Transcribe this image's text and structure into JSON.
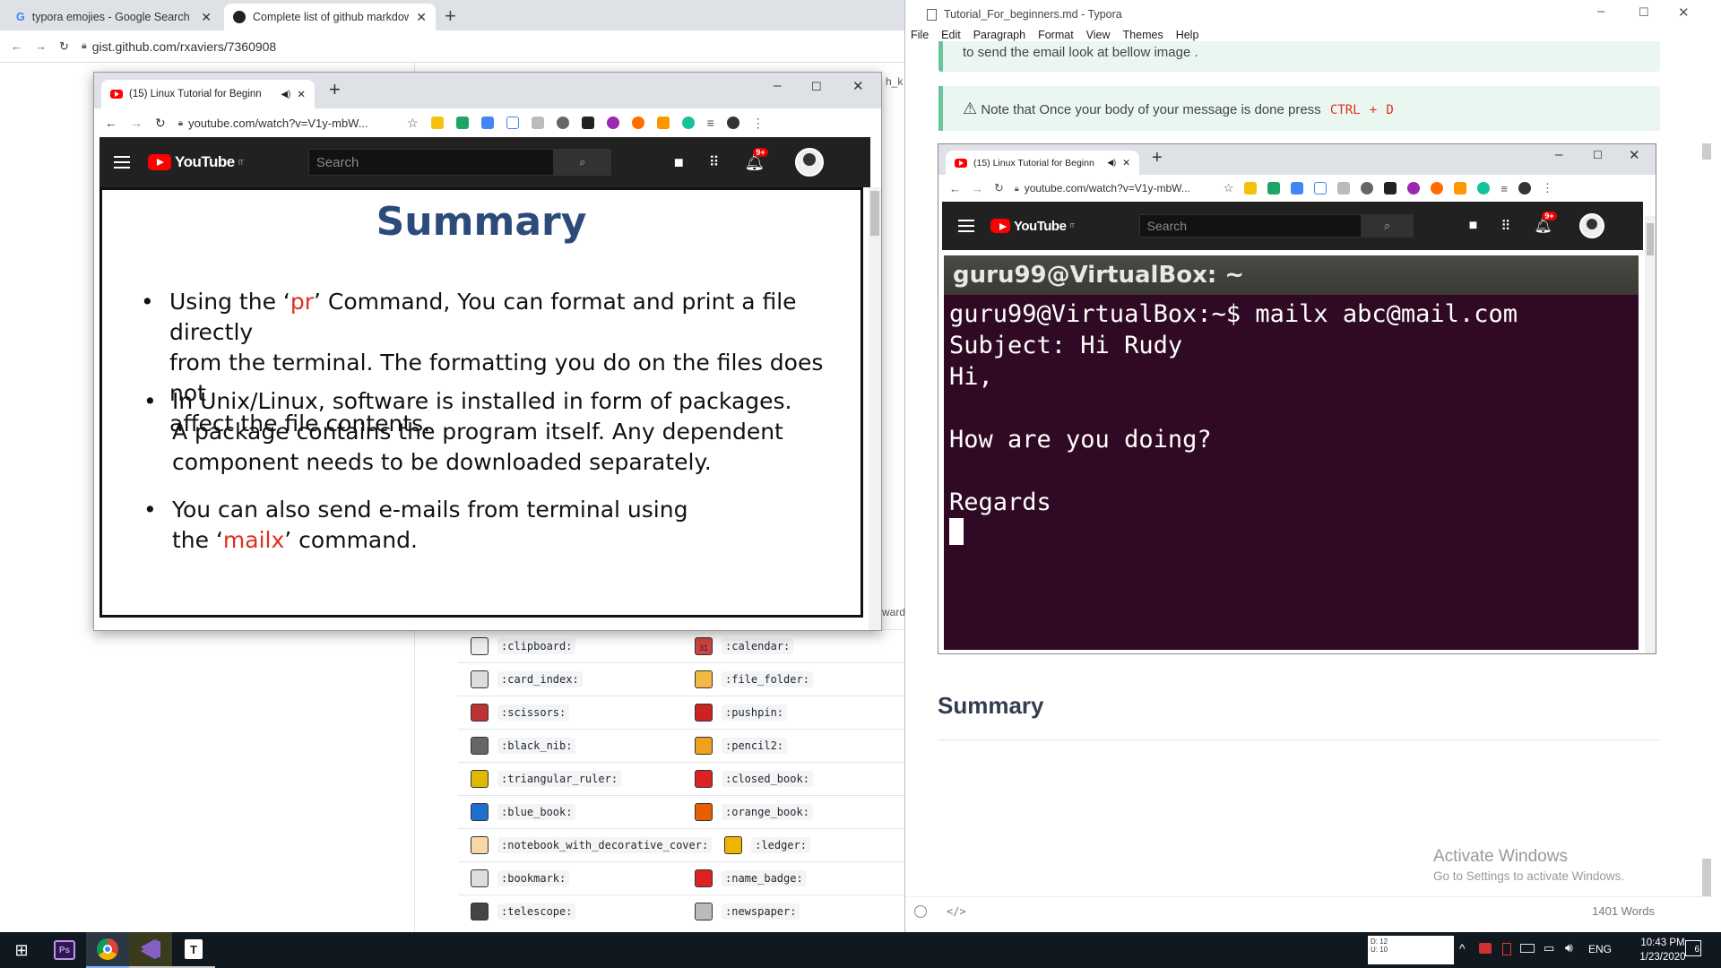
{
  "bg_browser": {
    "tabs": [
      {
        "title": "typora emojies - Google Search",
        "favicon": "google-icon"
      },
      {
        "title": "Complete list of github markdow",
        "favicon": "github-icon"
      }
    ],
    "url": "gist.github.com/rxaviers/7360908"
  },
  "emoji_table": {
    "rows": [
      {
        "left": ":clipboard:",
        "right": ":calendar:"
      },
      {
        "left": ":card_index:",
        "right": ":file_folder:"
      },
      {
        "left": ":scissors:",
        "right": ":pushpin:"
      },
      {
        "left": ":black_nib:",
        "right": ":pencil2:"
      },
      {
        "left": ":triangular_ruler:",
        "right": ":closed_book:"
      },
      {
        "left": ":blue_book:",
        "right": ":orange_book:"
      },
      {
        "left": ":notebook_with_decorative_cover:",
        "right": ":ledger:"
      },
      {
        "left": ":bookmark:",
        "right": ":name_badge:"
      },
      {
        "left": ":telescope:",
        "right": ":newspaper:"
      }
    ],
    "edge_fragments": {
      "top": "h_k",
      "mid": "ward"
    },
    "calendar_day": "31"
  },
  "yt_window_1": {
    "tab_title": "(15) Linux Tutorial for Beginn",
    "url": "youtube.com/watch?v=V1y-mbW...",
    "search_placeholder": "Search",
    "logo": "YouTube",
    "logo_sup": "IT",
    "notif_badge": "9+",
    "slide": {
      "title": "Summary",
      "b1_a": "Using the ‘",
      "b1_cmd": "pr",
      "b1_b": "’ Command, You can format and print a file directly",
      "b1_c": "from the terminal. The formatting you do on the files does not",
      "b1_d": "affect the file contents.",
      "b2_a": "In Unix/Linux, software is installed in form of packages.",
      "b2_b": "A package contains the program itself. Any dependent",
      "b2_c": "component needs to be downloaded separately.",
      "b3_a": "You can also send e-mails from terminal using",
      "b3_b": "the ‘",
      "b3_cmd": "mailx",
      "b3_c": "’ command.",
      "bullet": "•"
    }
  },
  "typora": {
    "title": "Tutorial_For_beginners.md - Typora",
    "menu": [
      "File",
      "Edit",
      "Paragraph",
      "Format",
      "View",
      "Themes",
      "Help"
    ],
    "note1": "to send the email look at bellow image .",
    "note2_text": "Note that Once your body of your message is done press",
    "note2_key1": "CTRL",
    "note2_plus": "+",
    "note2_key2": "D",
    "warning_symbol": "⚠",
    "heading": "Summary",
    "activate_title": "Activate Windows",
    "activate_sub": "Go to Settings to activate Windows.",
    "word_count": "1401 Words"
  },
  "yt_window_2": {
    "tab_title": "(15) Linux Tutorial for Beginn",
    "url": "youtube.com/watch?v=V1y-mbW...",
    "search_placeholder": "Search",
    "logo": "YouTube",
    "logo_sup": "IT",
    "notif_badge": "9+",
    "terminal": {
      "header": "guru99@VirtualBox: ~",
      "lines": [
        "guru99@VirtualBox:~$ mailx abc@mail.com",
        "Subject: Hi Rudy",
        "Hi,",
        "",
        "How are you doing?",
        "",
        "Regards"
      ]
    }
  },
  "taskbar": {
    "apps": [
      "photoshop-icon",
      "chrome-icon",
      "visual-studio-icon",
      "typora-icon"
    ],
    "meter_d": "D: 12",
    "meter_u": "U: 10",
    "lang": "ENG",
    "time": "10:43 PM",
    "date": "1/23/2020",
    "notif_count": "6"
  },
  "colors": {
    "accent_red": "#e0301e",
    "slide_title": "#2c4b7b",
    "terminal_bg": "#300a24",
    "note_bg": "#eaf7f0"
  }
}
